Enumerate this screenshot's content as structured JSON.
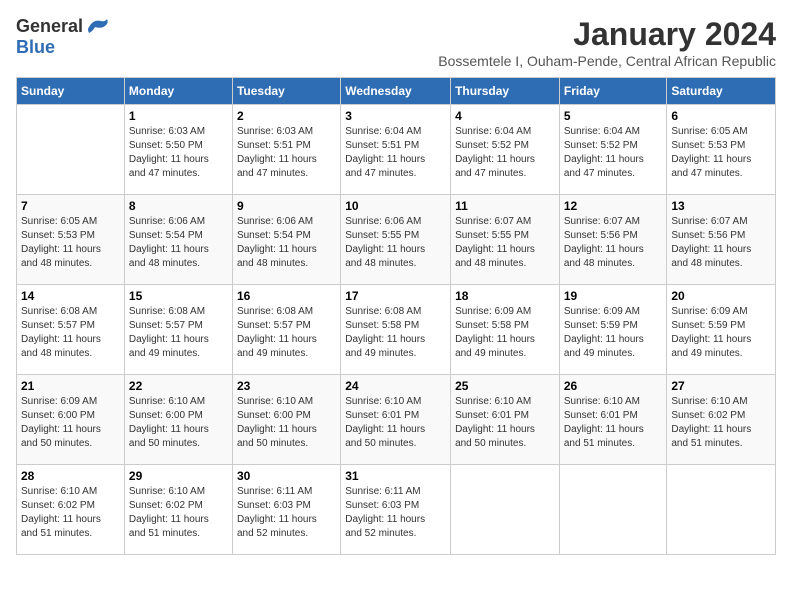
{
  "logo": {
    "general": "General",
    "blue": "Blue"
  },
  "title": "January 2024",
  "subtitle": "Bossemtele I, Ouham-Pende, Central African Republic",
  "days_of_week": [
    "Sunday",
    "Monday",
    "Tuesday",
    "Wednesday",
    "Thursday",
    "Friday",
    "Saturday"
  ],
  "weeks": [
    [
      {
        "day": "",
        "info": ""
      },
      {
        "day": "1",
        "info": "Sunrise: 6:03 AM\nSunset: 5:50 PM\nDaylight: 11 hours\nand 47 minutes."
      },
      {
        "day": "2",
        "info": "Sunrise: 6:03 AM\nSunset: 5:51 PM\nDaylight: 11 hours\nand 47 minutes."
      },
      {
        "day": "3",
        "info": "Sunrise: 6:04 AM\nSunset: 5:51 PM\nDaylight: 11 hours\nand 47 minutes."
      },
      {
        "day": "4",
        "info": "Sunrise: 6:04 AM\nSunset: 5:52 PM\nDaylight: 11 hours\nand 47 minutes."
      },
      {
        "day": "5",
        "info": "Sunrise: 6:04 AM\nSunset: 5:52 PM\nDaylight: 11 hours\nand 47 minutes."
      },
      {
        "day": "6",
        "info": "Sunrise: 6:05 AM\nSunset: 5:53 PM\nDaylight: 11 hours\nand 47 minutes."
      }
    ],
    [
      {
        "day": "7",
        "info": "Sunrise: 6:05 AM\nSunset: 5:53 PM\nDaylight: 11 hours\nand 48 minutes."
      },
      {
        "day": "8",
        "info": "Sunrise: 6:06 AM\nSunset: 5:54 PM\nDaylight: 11 hours\nand 48 minutes."
      },
      {
        "day": "9",
        "info": "Sunrise: 6:06 AM\nSunset: 5:54 PM\nDaylight: 11 hours\nand 48 minutes."
      },
      {
        "day": "10",
        "info": "Sunrise: 6:06 AM\nSunset: 5:55 PM\nDaylight: 11 hours\nand 48 minutes."
      },
      {
        "day": "11",
        "info": "Sunrise: 6:07 AM\nSunset: 5:55 PM\nDaylight: 11 hours\nand 48 minutes."
      },
      {
        "day": "12",
        "info": "Sunrise: 6:07 AM\nSunset: 5:56 PM\nDaylight: 11 hours\nand 48 minutes."
      },
      {
        "day": "13",
        "info": "Sunrise: 6:07 AM\nSunset: 5:56 PM\nDaylight: 11 hours\nand 48 minutes."
      }
    ],
    [
      {
        "day": "14",
        "info": "Sunrise: 6:08 AM\nSunset: 5:57 PM\nDaylight: 11 hours\nand 48 minutes."
      },
      {
        "day": "15",
        "info": "Sunrise: 6:08 AM\nSunset: 5:57 PM\nDaylight: 11 hours\nand 49 minutes."
      },
      {
        "day": "16",
        "info": "Sunrise: 6:08 AM\nSunset: 5:57 PM\nDaylight: 11 hours\nand 49 minutes."
      },
      {
        "day": "17",
        "info": "Sunrise: 6:08 AM\nSunset: 5:58 PM\nDaylight: 11 hours\nand 49 minutes."
      },
      {
        "day": "18",
        "info": "Sunrise: 6:09 AM\nSunset: 5:58 PM\nDaylight: 11 hours\nand 49 minutes."
      },
      {
        "day": "19",
        "info": "Sunrise: 6:09 AM\nSunset: 5:59 PM\nDaylight: 11 hours\nand 49 minutes."
      },
      {
        "day": "20",
        "info": "Sunrise: 6:09 AM\nSunset: 5:59 PM\nDaylight: 11 hours\nand 49 minutes."
      }
    ],
    [
      {
        "day": "21",
        "info": "Sunrise: 6:09 AM\nSunset: 6:00 PM\nDaylight: 11 hours\nand 50 minutes."
      },
      {
        "day": "22",
        "info": "Sunrise: 6:10 AM\nSunset: 6:00 PM\nDaylight: 11 hours\nand 50 minutes."
      },
      {
        "day": "23",
        "info": "Sunrise: 6:10 AM\nSunset: 6:00 PM\nDaylight: 11 hours\nand 50 minutes."
      },
      {
        "day": "24",
        "info": "Sunrise: 6:10 AM\nSunset: 6:01 PM\nDaylight: 11 hours\nand 50 minutes."
      },
      {
        "day": "25",
        "info": "Sunrise: 6:10 AM\nSunset: 6:01 PM\nDaylight: 11 hours\nand 50 minutes."
      },
      {
        "day": "26",
        "info": "Sunrise: 6:10 AM\nSunset: 6:01 PM\nDaylight: 11 hours\nand 51 minutes."
      },
      {
        "day": "27",
        "info": "Sunrise: 6:10 AM\nSunset: 6:02 PM\nDaylight: 11 hours\nand 51 minutes."
      }
    ],
    [
      {
        "day": "28",
        "info": "Sunrise: 6:10 AM\nSunset: 6:02 PM\nDaylight: 11 hours\nand 51 minutes."
      },
      {
        "day": "29",
        "info": "Sunrise: 6:10 AM\nSunset: 6:02 PM\nDaylight: 11 hours\nand 51 minutes."
      },
      {
        "day": "30",
        "info": "Sunrise: 6:11 AM\nSunset: 6:03 PM\nDaylight: 11 hours\nand 52 minutes."
      },
      {
        "day": "31",
        "info": "Sunrise: 6:11 AM\nSunset: 6:03 PM\nDaylight: 11 hours\nand 52 minutes."
      },
      {
        "day": "",
        "info": ""
      },
      {
        "day": "",
        "info": ""
      },
      {
        "day": "",
        "info": ""
      }
    ]
  ]
}
